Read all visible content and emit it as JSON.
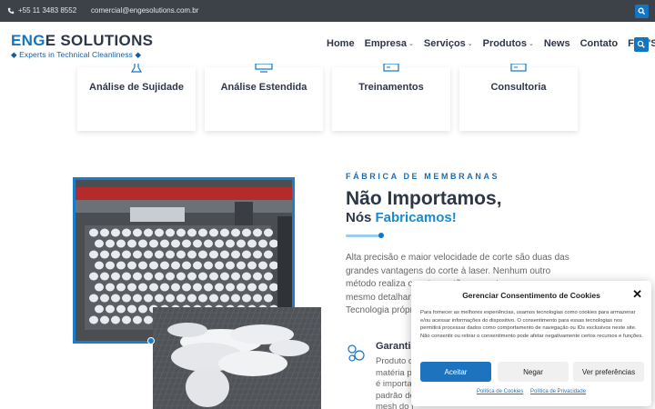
{
  "topbar": {
    "phone": "+55 11 3483 8552",
    "email": "comercial@engesolutions.com.br",
    "search_icon": "search-icon"
  },
  "header": {
    "brand_en": "EN",
    "brand_g": "G",
    "brand_rest": "E SOLUTIONS",
    "tagline": "◆ Experts in Technical Cleanliness ◆",
    "nav": [
      {
        "label": "Home",
        "dropdown": false
      },
      {
        "label": "Empresa",
        "dropdown": true
      },
      {
        "label": "Serviços",
        "dropdown": true
      },
      {
        "label": "Produtos",
        "dropdown": true
      },
      {
        "label": "News",
        "dropdown": false
      },
      {
        "label": "Contato",
        "dropdown": false
      },
      {
        "label": "FAQ'S",
        "dropdown": false
      }
    ]
  },
  "services": [
    {
      "label": "Análise de Sujidade",
      "icon": "flask-icon"
    },
    {
      "label": "Análise Estendida",
      "icon": "monitor-icon"
    },
    {
      "label": "Treinamentos",
      "icon": "presentation-icon"
    },
    {
      "label": "Consultoria",
      "icon": "presentation-icon"
    }
  ],
  "section": {
    "kicker": "FÁBRICA DE MEMBRANAS",
    "title": "Não Importamos,",
    "subtitle_pre": "Nós ",
    "subtitle_highlight": "Fabricamos!",
    "paragraph": "Alta precisão e maior velocidade de corte são duas das grandes vantagens do corte à laser. Nenhum outro método realiza o corte em tão pouco tempo e com o mesmo detalhamento. Nossas membranas são únicos. Tecnologia própria.",
    "feature_title": "Garantia",
    "feature_text": "Produto de matéria prima é importado padrão de mesh do f"
  },
  "cookie": {
    "title": "Gerenciar Consentimento de Cookies",
    "body": "Para fornecer as melhores experiências, usamos tecnologias como cookies para armazenar e/ou acessar informações do dispositivo. O consentimento para essas tecnologias nos permitirá processar dados como comportamento de navegação ou IDs exclusivos neste site. Não consentir ou retirar o consentimento pode afetar negativamente certos recursos e funções.",
    "accept": "Aceitar",
    "deny": "Negar",
    "preferences": "Ver preferências",
    "link_cookies": "Política de Cookies",
    "link_privacy": "Política de Privacidade"
  },
  "colors": {
    "accent": "#1475c2",
    "topbar": "#3d4148",
    "heading": "#2e3748"
  }
}
